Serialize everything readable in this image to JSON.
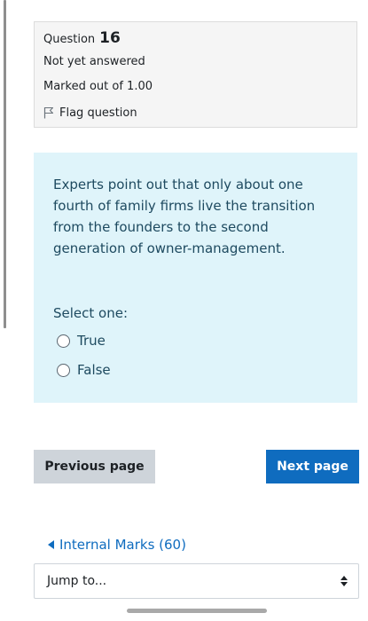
{
  "question_info": {
    "question_label": "Question",
    "question_number": "16",
    "status": "Not yet answered",
    "marks": "Marked out of 1.00",
    "flag_label": "Flag question"
  },
  "question": {
    "text": "Experts point out that only about one fourth of family firms live the transition from the founders to the second generation of owner-management.",
    "select_label": "Select one:",
    "options": [
      {
        "label": "True"
      },
      {
        "label": "False"
      }
    ]
  },
  "navigation": {
    "previous_label": "Previous page",
    "next_label": "Next page",
    "back_link_label": "Internal Marks (60)",
    "jump_to_label": "Jump to..."
  },
  "colors": {
    "accent": "#0f6cbf",
    "question_bg": "#dff4fa",
    "info_bg": "#f5f5f5",
    "secondary_button": "#ced4da"
  },
  "icons": {
    "flag": "flag-outline-icon",
    "back": "triangle-left-icon",
    "select": "updown-chevron-icon"
  }
}
